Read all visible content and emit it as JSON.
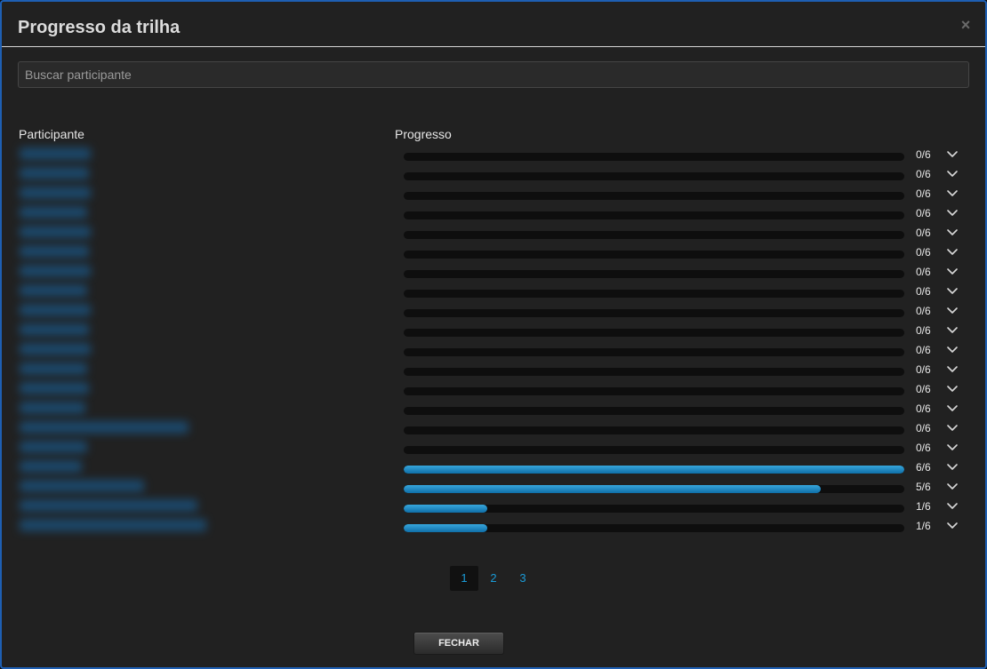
{
  "modal": {
    "title": "Progresso da trilha",
    "close_symbol": "×",
    "search_placeholder": "Buscar participante",
    "columns": {
      "participant": "Participante",
      "progress": "Progresso"
    },
    "rows": [
      {
        "completed": 0,
        "total": 6,
        "label": "0/6"
      },
      {
        "completed": 0,
        "total": 6,
        "label": "0/6"
      },
      {
        "completed": 0,
        "total": 6,
        "label": "0/6"
      },
      {
        "completed": 0,
        "total": 6,
        "label": "0/6"
      },
      {
        "completed": 0,
        "total": 6,
        "label": "0/6"
      },
      {
        "completed": 0,
        "total": 6,
        "label": "0/6"
      },
      {
        "completed": 0,
        "total": 6,
        "label": "0/6"
      },
      {
        "completed": 0,
        "total": 6,
        "label": "0/6"
      },
      {
        "completed": 0,
        "total": 6,
        "label": "0/6"
      },
      {
        "completed": 0,
        "total": 6,
        "label": "0/6"
      },
      {
        "completed": 0,
        "total": 6,
        "label": "0/6"
      },
      {
        "completed": 0,
        "total": 6,
        "label": "0/6"
      },
      {
        "completed": 0,
        "total": 6,
        "label": "0/6"
      },
      {
        "completed": 0,
        "total": 6,
        "label": "0/6"
      },
      {
        "completed": 0,
        "total": 6,
        "label": "0/6"
      },
      {
        "completed": 0,
        "total": 6,
        "label": "0/6"
      },
      {
        "completed": 6,
        "total": 6,
        "label": "6/6"
      },
      {
        "completed": 5,
        "total": 6,
        "label": "5/6"
      },
      {
        "completed": 1,
        "total": 6,
        "label": "1/6"
      },
      {
        "completed": 1,
        "total": 6,
        "label": "1/6"
      }
    ],
    "pagination": {
      "pages": [
        "1",
        "2",
        "3"
      ],
      "current": "1"
    },
    "footer": {
      "close_label": "FECHAR"
    },
    "colors": {
      "accent": "#1a9bd7",
      "border": "#1e5fb3",
      "background": "#212121"
    },
    "icons": {
      "close": "close-icon",
      "expand": "chevron-down-icon"
    }
  }
}
